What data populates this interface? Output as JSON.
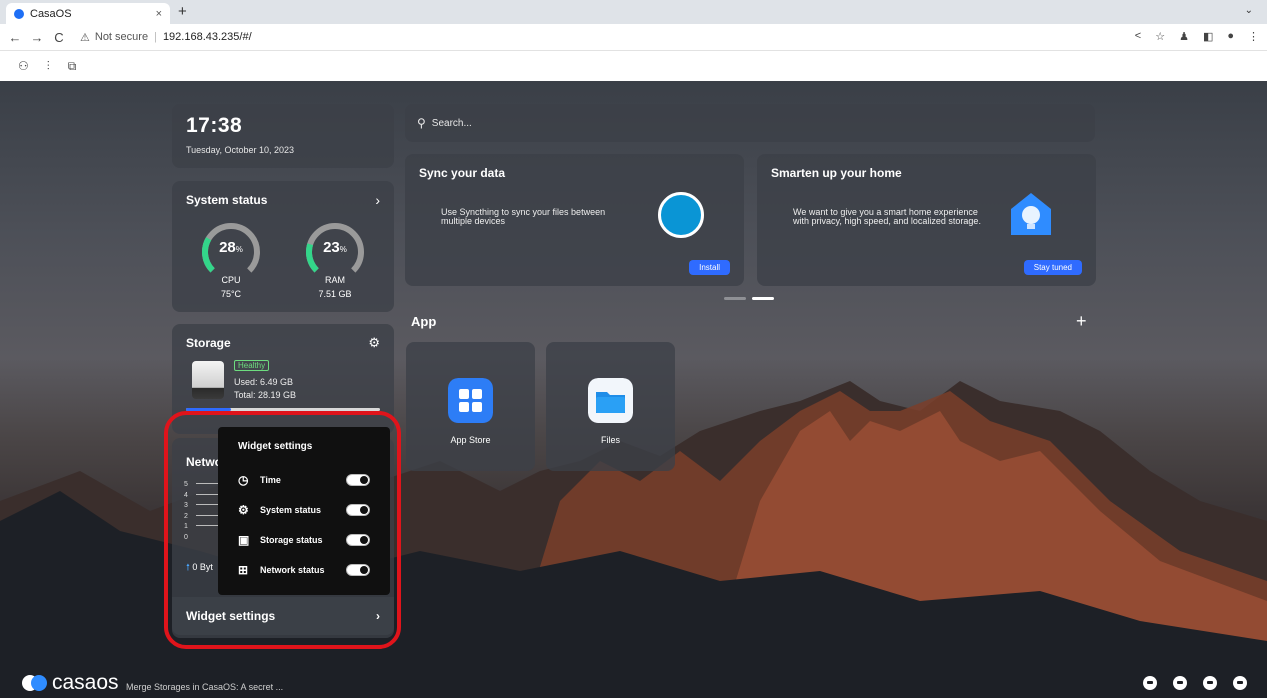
{
  "browser": {
    "tab_title": "CasaOS",
    "tab_close": "×",
    "new_tab": "+",
    "tab_menu": "⌄",
    "nav": {
      "back": "←",
      "forward": "→",
      "reload": "C"
    },
    "security_icon": "⚠",
    "not_secure": "Not secure",
    "separator": "|",
    "url": "192.168.43.235/#/",
    "right_icons": [
      "<",
      "☆",
      "♟",
      "◧",
      "●",
      "⋮"
    ]
  },
  "toolbar_icons": [
    "⚇",
    "⫶",
    "⧉"
  ],
  "widgets": {
    "time": {
      "clock": "17:38",
      "date": "Tuesday, October 10, 2023"
    },
    "system_status": {
      "title": "System status",
      "chevron": "›",
      "cpu": {
        "value": "28",
        "unit": "%",
        "label": "CPU",
        "sub": "75°C",
        "fraction": 0.28
      },
      "ram": {
        "value": "23",
        "unit": "%",
        "label": "RAM",
        "sub": "7.51 GB",
        "fraction": 0.23
      }
    },
    "storage": {
      "title": "Storage",
      "gear": "⚙",
      "health": "Healthy",
      "used": "Used: 6.49 GB",
      "total": "Total: 28.19 GB",
      "used_fraction": 0.23
    },
    "network": {
      "title_partial": "Netwo",
      "axis": [
        "5",
        "4",
        "3",
        "2",
        "1",
        "0"
      ],
      "arrow": "🠕",
      "rate_partial": "0 Byt"
    },
    "widget_settings_bar": {
      "label": "Widget settings",
      "chevron": "›"
    }
  },
  "popup": {
    "title": "Widget settings",
    "items": [
      {
        "icon": "◷",
        "label": "Time",
        "on": true
      },
      {
        "icon": "⚙",
        "label": "System status",
        "on": true
      },
      {
        "icon": "▣",
        "label": "Storage status",
        "on": true
      },
      {
        "icon": "⊞",
        "label": "Network status",
        "on": true
      }
    ]
  },
  "search": {
    "icon": "⚲",
    "placeholder": "Search..."
  },
  "promos": [
    {
      "title": "Sync your data",
      "text": "Use Syncthing to sync your files between multiple devices",
      "button": "Install"
    },
    {
      "title": "Smarten up your home",
      "text": "We want to give you a smart home experience with privacy, high speed, and localized storage.",
      "button": "Stay tuned"
    }
  ],
  "apps": {
    "title": "App",
    "add": "+",
    "items": [
      {
        "name": "App Store"
      },
      {
        "name": "Files"
      }
    ]
  },
  "footer": {
    "brand": "casaos",
    "news": "Merge Storages in CasaOS: A secret ..."
  },
  "colors": {
    "accent": "#2f6bff",
    "gauge_green": "#33d68a",
    "highlight": "#e0141b",
    "healthy": "#6ddc7f"
  }
}
